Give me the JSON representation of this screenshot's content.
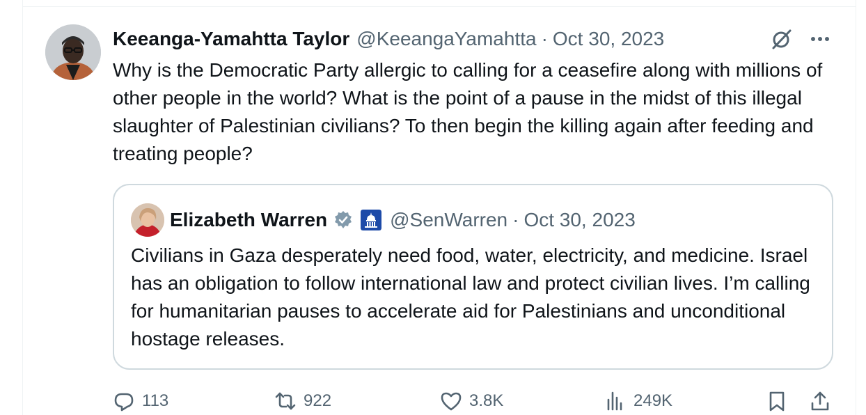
{
  "post": {
    "author_name": "Keeanga-Yamahtta Taylor",
    "author_handle": "@KeeangaYamahtta",
    "separator": "·",
    "date": "Oct 30, 2023",
    "text": "Why is the Democratic Party allergic to calling for a ceasefire along with millions of other people in the world? What is the point of a pause in the midst of this illegal slaughter of Palestinian civilians? To then begin the killing again after feeding and treating people?"
  },
  "quote": {
    "author_name": "Elizabeth Warren",
    "author_handle": "@SenWarren",
    "separator": "·",
    "date": "Oct 30, 2023",
    "text": "Civilians in Gaza desperately need food, water, electricity, and medicine. Israel has an obligation to follow international law and protect civilian lives. I’m calling for humanitarian pauses to accelerate aid for Palestinians and unconditional hostage releases."
  },
  "actions": {
    "replies": "113",
    "reposts": "922",
    "likes": "3.8K",
    "views": "249K"
  },
  "icons": [
    "grok-icon",
    "more-icon",
    "verified-icon",
    "capitol-icon",
    "reply-icon",
    "repost-icon",
    "like-icon",
    "views-icon",
    "bookmark-icon",
    "share-icon"
  ],
  "colors": {
    "text": "#0f1419",
    "secondary": "#536471",
    "border": "#cfd9de",
    "verified": "#829aab",
    "affiliation_bg": "#1d4aa8"
  }
}
